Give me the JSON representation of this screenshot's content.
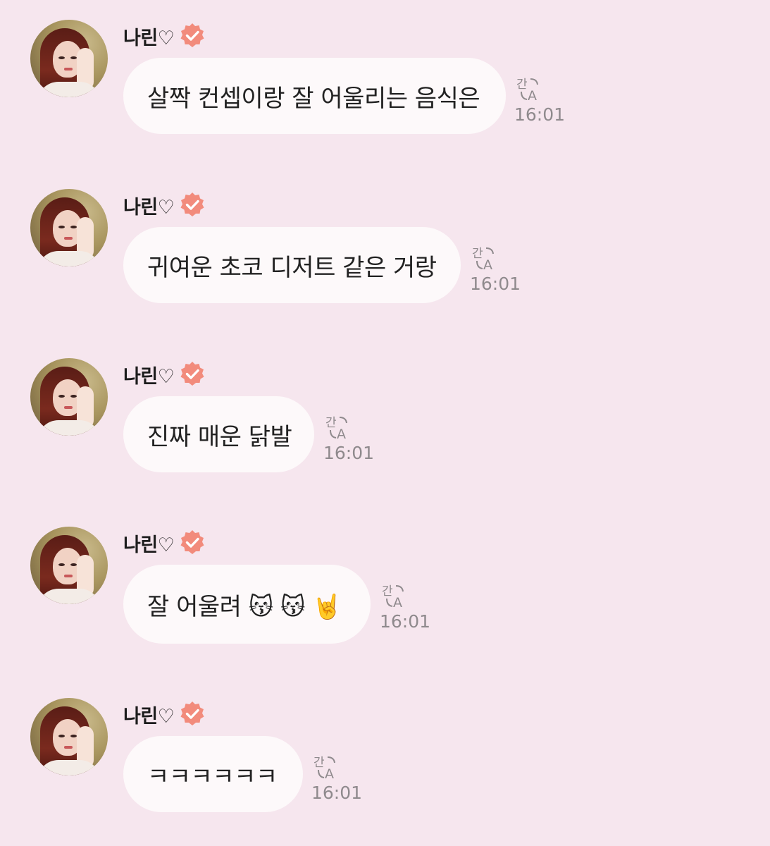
{
  "colors": {
    "background": "#f6e6ee",
    "bubble": "#fdf9fa",
    "verified_badge": "#f28b7c",
    "time_text": "#8f8a8d"
  },
  "messages": [
    {
      "sender": "나린♡",
      "text": "살짝 컨셉이랑 잘 어울리는 음식은",
      "time": "16:01",
      "verified_icon": "verified-badge-icon",
      "translate_icon": "translate-icon"
    },
    {
      "sender": "나린♡",
      "text": "귀여운 초코 디저트 같은 거랑",
      "time": "16:01",
      "verified_icon": "verified-badge-icon",
      "translate_icon": "translate-icon"
    },
    {
      "sender": "나린♡",
      "text": "진짜 매운 닭발",
      "time": "16:01",
      "verified_icon": "verified-badge-icon",
      "translate_icon": "translate-icon"
    },
    {
      "sender": "나린♡",
      "text": "잘 어울려 😽 😽 🤘",
      "time": "16:01",
      "verified_icon": "verified-badge-icon",
      "translate_icon": "translate-icon"
    },
    {
      "sender": "나린♡",
      "text": "ㅋㅋㅋㅋㅋㅋ",
      "time": "16:01",
      "verified_icon": "verified-badge-icon",
      "translate_icon": "translate-icon"
    }
  ],
  "translate_glyphs": {
    "korean": "간",
    "latin": "A"
  }
}
